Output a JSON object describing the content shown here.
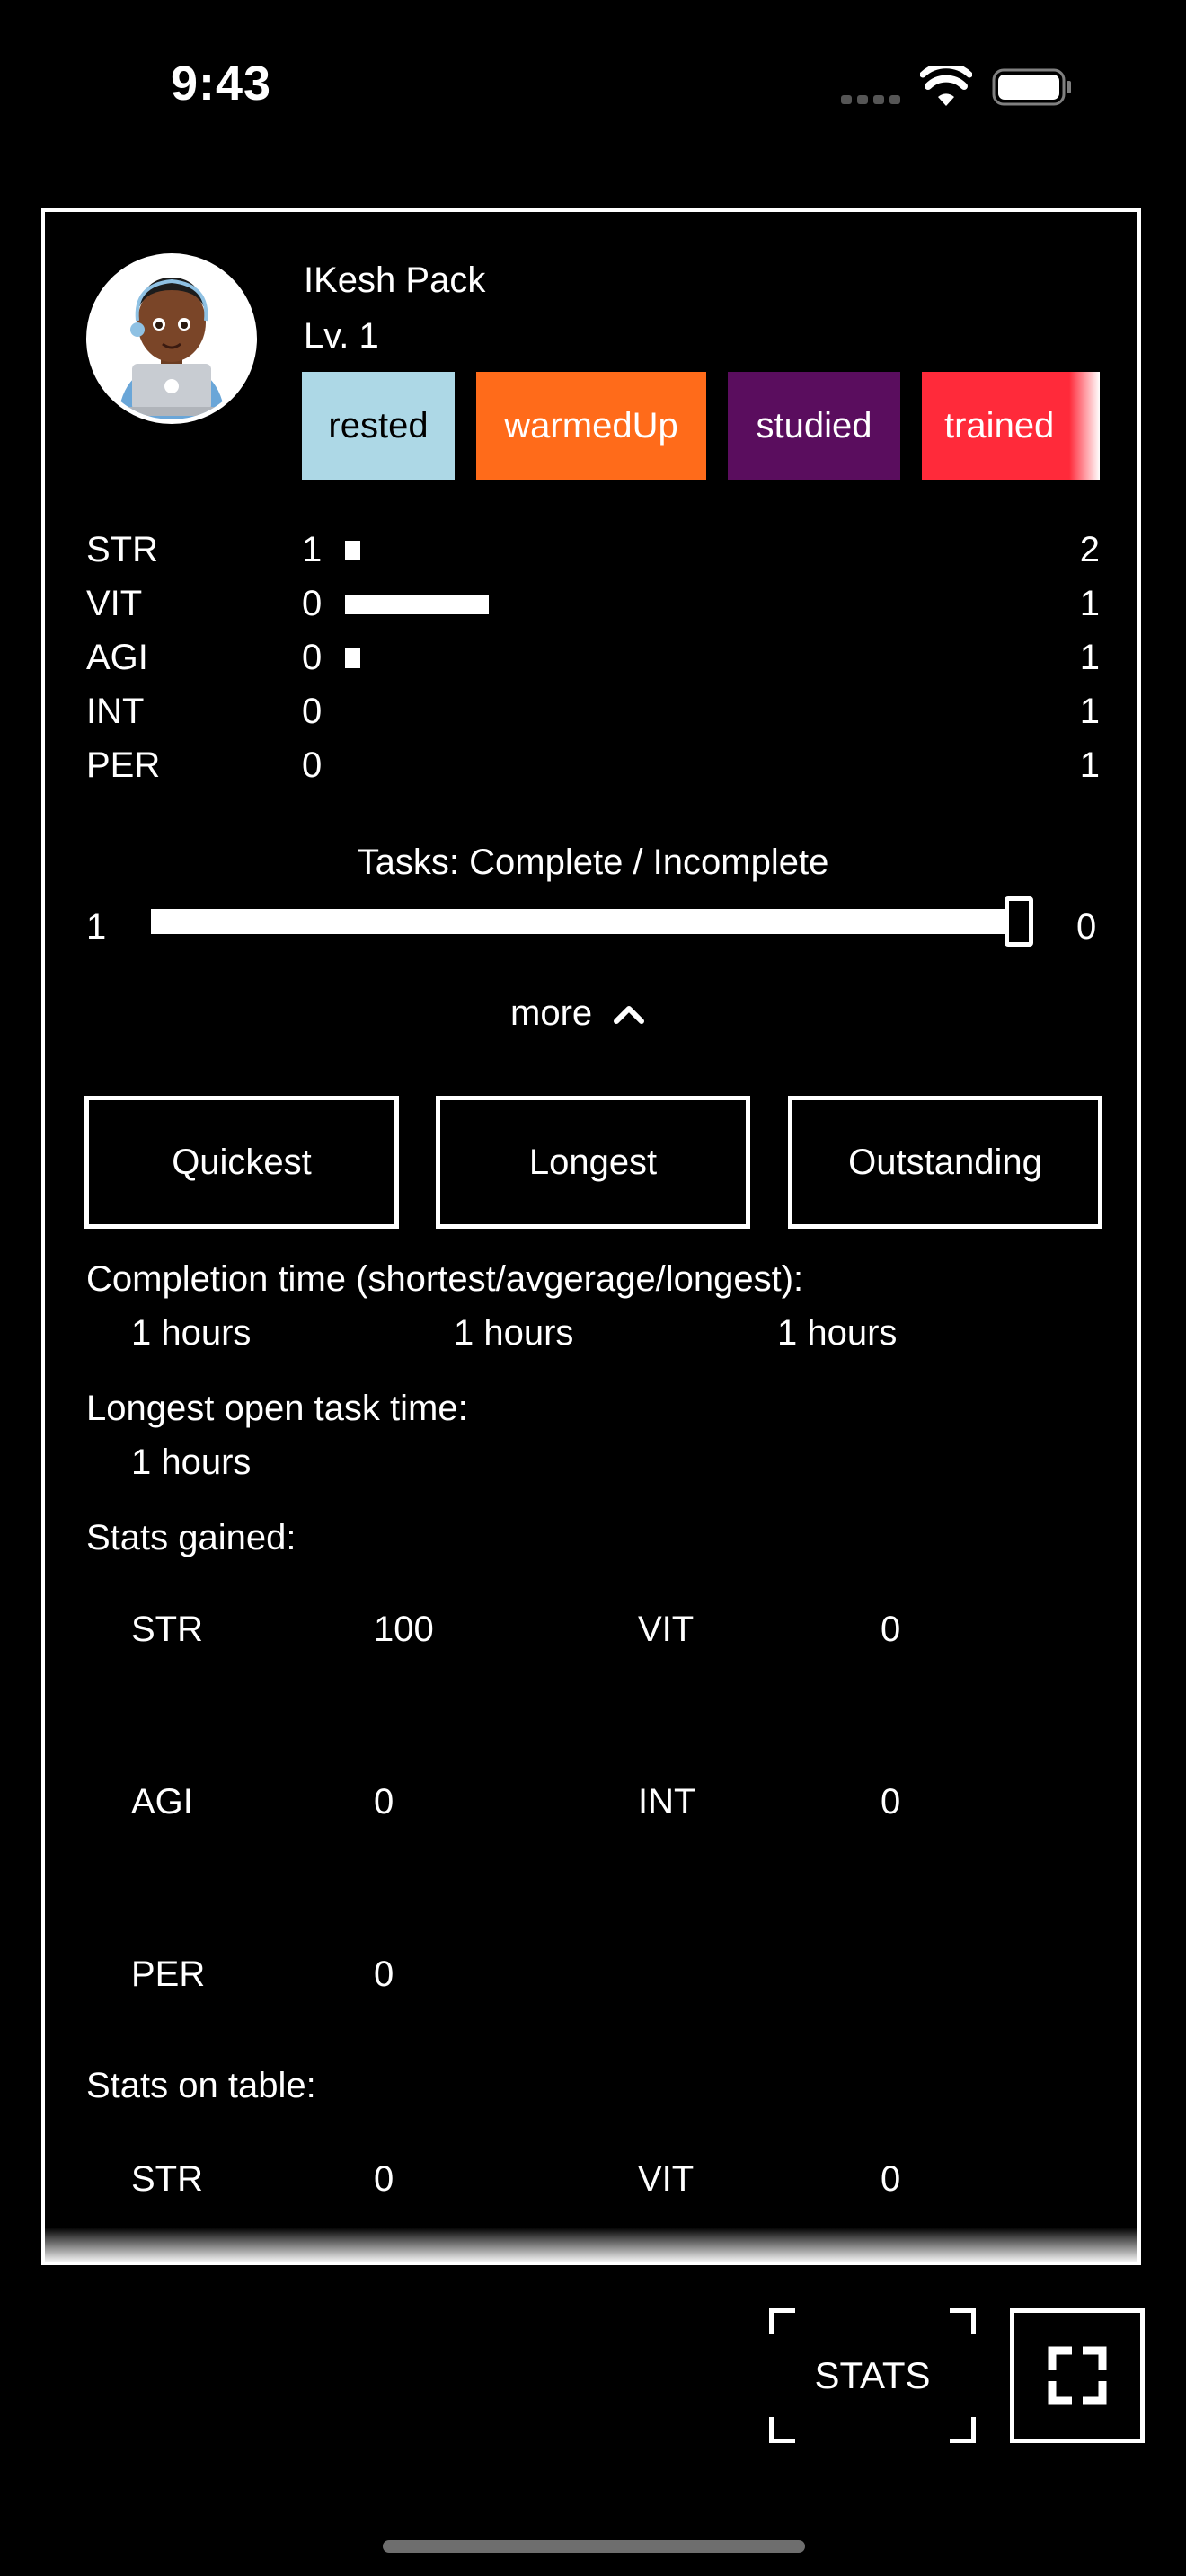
{
  "status_bar": {
    "time": "9:43",
    "icons": [
      "signal-icon",
      "wifi-icon",
      "battery-icon"
    ]
  },
  "profile": {
    "name": "IKesh Pack",
    "level": "Lv. 1",
    "avatar_icon": "memoji-avatar-with-laptop"
  },
  "tags": [
    {
      "label": "rested",
      "bg": "#ADD8E6",
      "fg": "#000000"
    },
    {
      "label": "warmedUp",
      "bg": "#FF6B1A",
      "fg": "#FFFFFF"
    },
    {
      "label": "studied",
      "bg": "#5A0D5E",
      "fg": "#FFFFFF"
    },
    {
      "label": "trained",
      "bg": "#FF2A3A",
      "fg": "#FFFFFF"
    }
  ],
  "stats": [
    {
      "name": "STR",
      "value": "1",
      "max": "2",
      "bar_fraction": 0.02
    },
    {
      "name": "VIT",
      "value": "0",
      "max": "1",
      "bar_fraction": 0.19
    },
    {
      "name": "AGI",
      "value": "0",
      "max": "1",
      "bar_fraction": 0.02
    },
    {
      "name": "INT",
      "value": "0",
      "max": "1",
      "bar_fraction": 0
    },
    {
      "name": "PER",
      "value": "0",
      "max": "1",
      "bar_fraction": 0
    }
  ],
  "tasks": {
    "title": "Tasks: Complete / Incomplete",
    "complete": "1",
    "incomplete": "0",
    "complete_fraction": 1.0
  },
  "more_label": "more",
  "filter_buttons": [
    "Quickest",
    "Longest",
    "Outstanding"
  ],
  "completion_time": {
    "label": "Completion time (shortest/avgerage/longest):",
    "values": [
      "1 hours",
      "1 hours",
      "1 hours"
    ]
  },
  "longest_open": {
    "label": "Longest open task time:",
    "value": "1 hours"
  },
  "stats_gained": {
    "label": "Stats gained:",
    "items": [
      {
        "name": "STR",
        "value": "100"
      },
      {
        "name": "VIT",
        "value": "0"
      },
      {
        "name": "AGI",
        "value": "0"
      },
      {
        "name": "INT",
        "value": "0"
      },
      {
        "name": "PER",
        "value": "0"
      }
    ]
  },
  "stats_on_table": {
    "label": "Stats on table:",
    "items": [
      {
        "name": "STR",
        "value": "0"
      },
      {
        "name": "VIT",
        "value": "0"
      }
    ]
  },
  "bottom_bar": {
    "stats_label": "STATS",
    "fullscreen_icon": "fullscreen-icon"
  }
}
